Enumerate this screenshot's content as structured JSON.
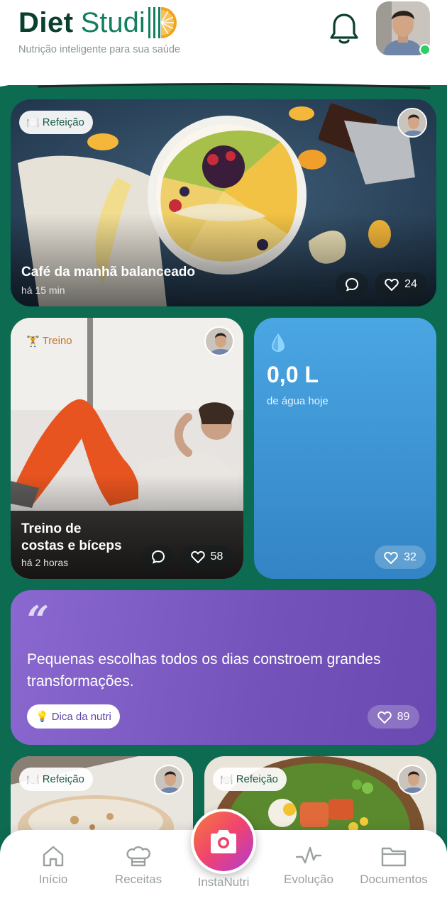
{
  "header": {
    "logo_part1": "Diet",
    "logo_part2": "Studi",
    "tagline": "Nutrição inteligente para sua saúde"
  },
  "feed": {
    "meal_card": {
      "chip": "Refeição",
      "title": "Café da manhã balanceado",
      "time": "há 15 min",
      "likes": "24"
    },
    "workout_card": {
      "chip": "Treino",
      "title_line1": "Treino de",
      "title_line2": "costas e bíceps",
      "time": "há 2 horas",
      "likes": "58"
    },
    "water_card": {
      "value": "0,0 L",
      "label": "de água hoje",
      "likes": "32"
    },
    "tip_card": {
      "quote_mark": "“",
      "text": "Pequenas escolhas todos os dias constroem grandes transformações.",
      "chip": "Dica da nutri",
      "likes": "89"
    },
    "meal_card_b": {
      "chip": "Refeição"
    },
    "meal_card_c": {
      "chip": "Refeição"
    }
  },
  "nav": {
    "items": [
      {
        "label": "Início",
        "icon": "home-icon"
      },
      {
        "label": "Receitas",
        "icon": "chef-hat-icon"
      },
      {
        "label": "InstaNutri",
        "icon": "camera-icon"
      },
      {
        "label": "Evolução",
        "icon": "activity-icon"
      },
      {
        "label": "Documentos",
        "icon": "folder-icon"
      }
    ]
  },
  "colors": {
    "brand_dark": "#0b3f2e",
    "brand": "#11805f",
    "background": "#0d6b52",
    "water": "#3f94d6",
    "tip": "#7a5ac3",
    "online": "#2ccf65"
  }
}
